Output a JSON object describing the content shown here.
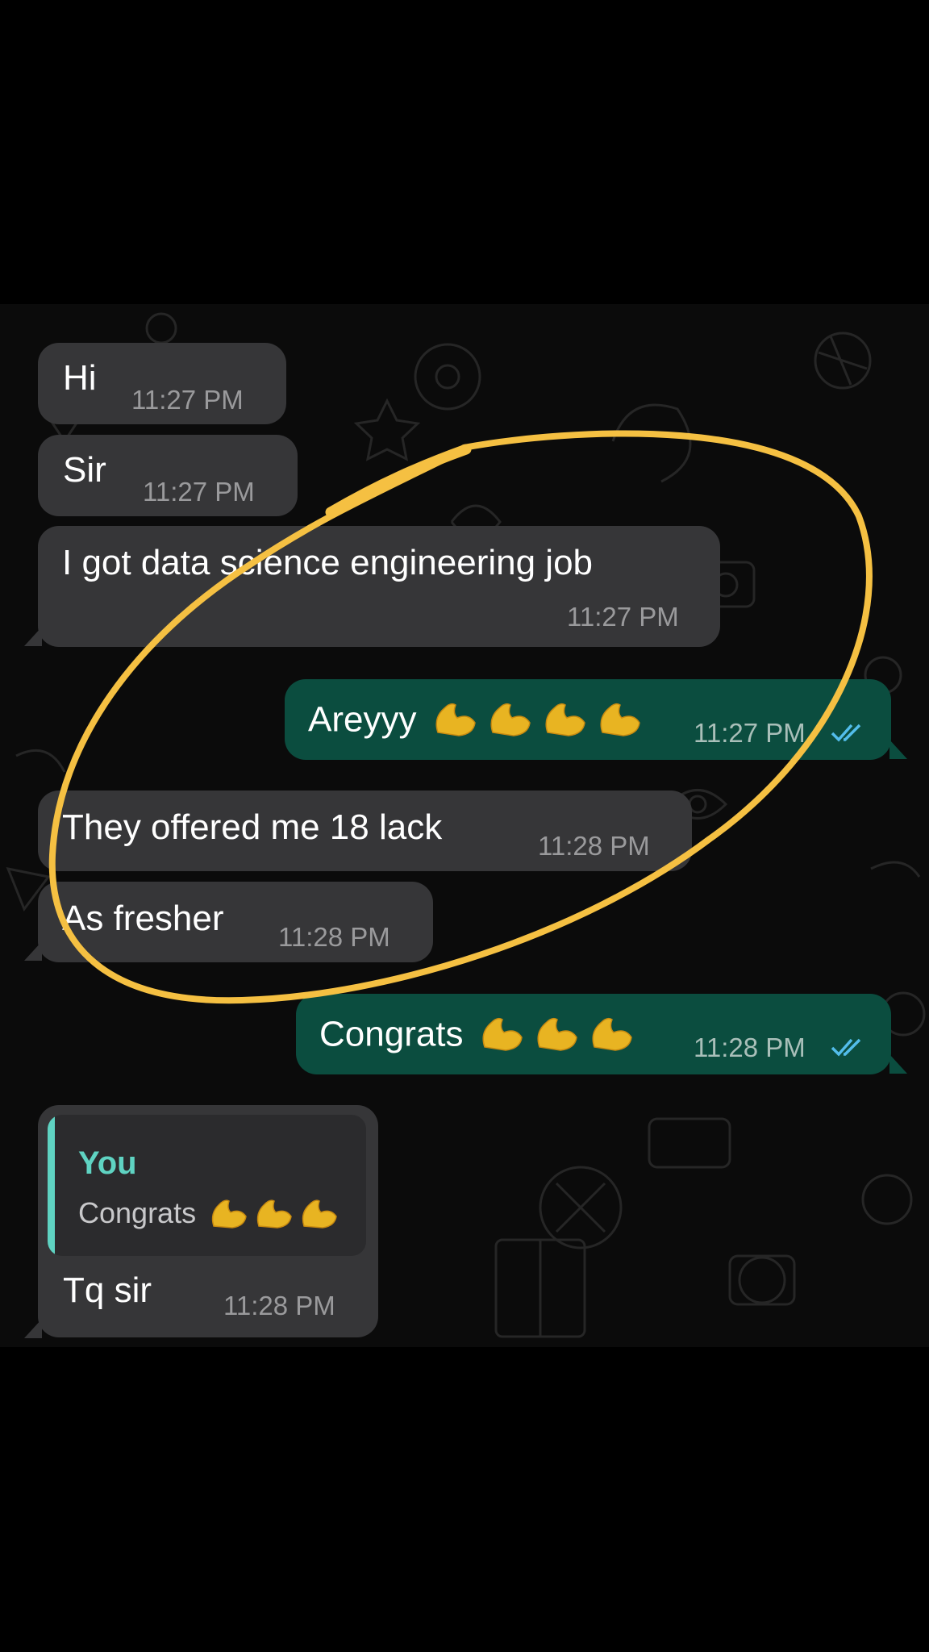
{
  "chat": {
    "messages": [
      {
        "id": "m1",
        "direction": "incoming",
        "text": "Hi",
        "time": "11:27 PM"
      },
      {
        "id": "m2",
        "direction": "incoming",
        "text": "Sir",
        "time": "11:27 PM"
      },
      {
        "id": "m3",
        "direction": "incoming",
        "text": "I got data science engineering job",
        "time": "11:27 PM"
      },
      {
        "id": "m4",
        "direction": "outgoing",
        "text": "Areyyy",
        "emoji": [
          "flexed-biceps",
          "flexed-biceps",
          "flexed-biceps",
          "flexed-biceps"
        ],
        "time": "11:27 PM",
        "status": "read"
      },
      {
        "id": "m5",
        "direction": "incoming",
        "text": "They offered me 18 lack",
        "time": "11:28 PM"
      },
      {
        "id": "m6",
        "direction": "incoming",
        "text": "As fresher",
        "time": "11:28 PM"
      },
      {
        "id": "m7",
        "direction": "outgoing",
        "text": "Congrats",
        "emoji": [
          "flexed-biceps",
          "flexed-biceps",
          "flexed-biceps"
        ],
        "time": "11:28 PM",
        "status": "read"
      },
      {
        "id": "m8",
        "direction": "incoming",
        "text": "Tq sir",
        "time": "11:28 PM",
        "reply_to": {
          "author": "You",
          "text": "Congrats",
          "emoji": [
            "flexed-biceps",
            "flexed-biceps",
            "flexed-biceps"
          ]
        }
      }
    ]
  },
  "colors": {
    "incoming_bubble": "#363638",
    "outgoing_bubble": "#0b4d3f",
    "read_ticks": "#53bdeb",
    "quote_accent": "#5fd3c2",
    "annotation": "#f5c042"
  },
  "annotation": {
    "shape": "hand-drawn-ellipse",
    "highlights": [
      "m3",
      "m4",
      "m5",
      "m6"
    ]
  }
}
